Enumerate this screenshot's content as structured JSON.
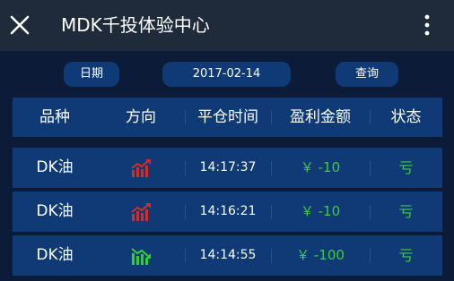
{
  "header": {
    "title": "MDK千投体验中心"
  },
  "filter": {
    "date_label": "日期",
    "date_value": "2017-02-14",
    "query_label": "查询"
  },
  "table": {
    "columns": [
      "品种",
      "方向",
      "平仓时间",
      "盈利金额",
      "状态"
    ],
    "rows": [
      {
        "name": "DK油",
        "direction_icon": "trend-up-icon",
        "direction_color": "#d62b2b",
        "time": "14:17:37",
        "pnl": "￥ -10",
        "status": "亏"
      },
      {
        "name": "DK油",
        "direction_icon": "trend-up-icon",
        "direction_color": "#d62b2b",
        "time": "14:16:21",
        "pnl": "￥ -10",
        "status": "亏"
      },
      {
        "name": "DK油",
        "direction_icon": "trend-down-icon",
        "direction_color": "#2fd02f",
        "time": "14:14:55",
        "pnl": "￥ -100",
        "status": "亏"
      }
    ]
  },
  "colors": {
    "background": "#0b1b38",
    "titlebar": "#1f2b3b",
    "panel": "#0f3a75",
    "loss_text": "#3ecb3e",
    "up_icon": "#d62b2b",
    "down_icon": "#2fd02f"
  }
}
